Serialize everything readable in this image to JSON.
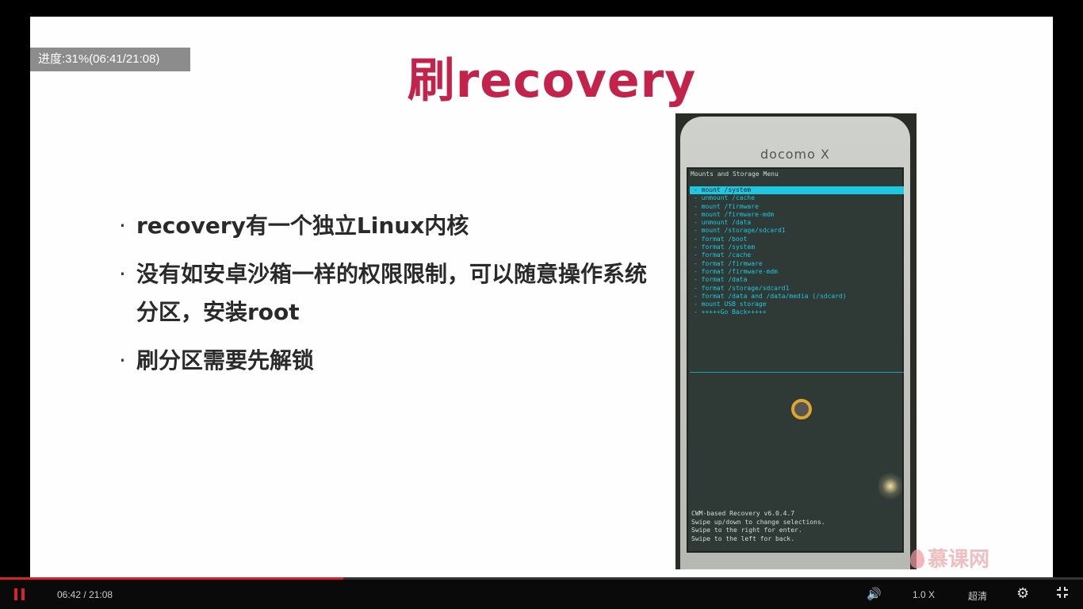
{
  "overlay": {
    "progress_text": "进度:31%(06:41/21:08)"
  },
  "slide": {
    "title": "刷recovery",
    "bullets": [
      {
        "dot": "·",
        "text": "recovery有一个独立Linux内核"
      },
      {
        "dot": "·",
        "text": "没有如安卓沙箱一样的权限限制，可以随意操作系统分区，安装root"
      },
      {
        "dot": "·",
        "text": "刷分区需要先解锁"
      }
    ]
  },
  "phone": {
    "brand": "docomo X",
    "screen_header": "Mounts and Storage Menu",
    "menu": [
      "- mount /system",
      "- unmount /cache",
      "- mount /firmware",
      "- mount /firmware-mdm",
      "- unmount /data",
      "- mount /storage/sdcard1",
      "- format /boot",
      "- format /system",
      "- format /cache",
      "- format /firmware",
      "- format /firmware-mdm",
      "- format /data",
      "- format /storage/sdcard1",
      "- format /data and /data/media (/sdcard)",
      "- mount USB storage",
      "- +++++Go Back+++++"
    ],
    "footer": [
      "CWM-based Recovery v6.0.4.7",
      "Swipe up/down to change selections.",
      "Swipe to the right for enter.",
      "Swipe to the left for back."
    ]
  },
  "watermark": {
    "text": "慕课网"
  },
  "player": {
    "current_time": "06:42",
    "separator": "/",
    "duration": "21:08",
    "played_fraction": 0.317,
    "speed": "1.0 X",
    "quality": "超清",
    "colors": {
      "accent": "#d82429",
      "title": "#c3234a"
    }
  }
}
